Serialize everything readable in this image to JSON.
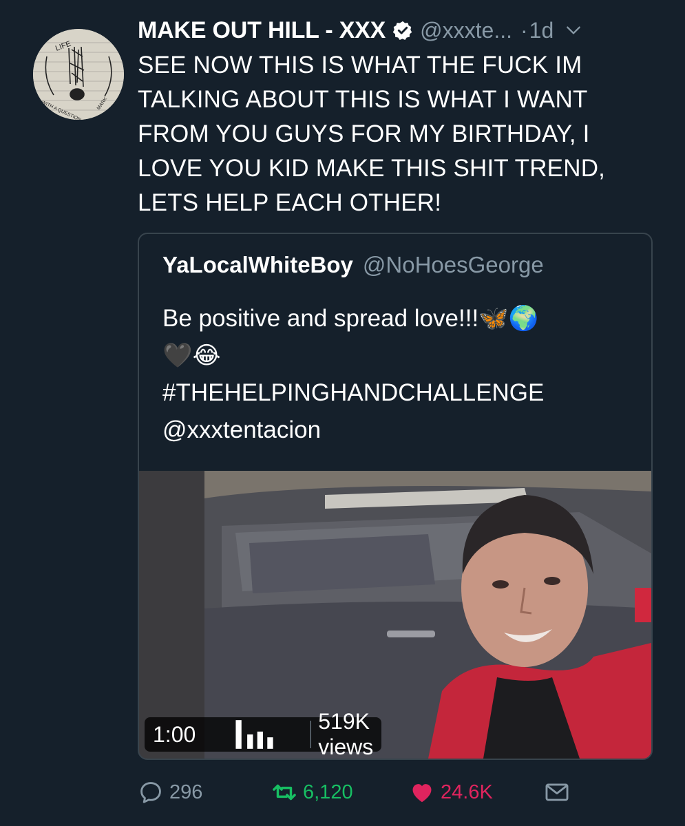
{
  "tweet": {
    "author_name": "MAKE OUT HILL - XXX",
    "handle": "@xxxte...",
    "separator": "·",
    "time": "1d",
    "text": "SEE NOW THIS IS WHAT THE FUCK IM TALKING ABOUT THIS IS WHAT I WANT FROM YOU GUYS FOR MY BIRTHDAY, I LOVE YOU KID MAKE THIS SHIT TREND, LETS HELP EACH OTHER!",
    "avatar_text": {
      "top": "LIFE",
      "bottom_left": "WITH A QUESTION",
      "bottom_right": "MARK"
    }
  },
  "quote": {
    "author_name": "YaLocalWhiteBoy",
    "handle": "@NoHoesGeorge",
    "line1": "Be positive and spread love!!!🦋🌍",
    "line2": "🖤😂",
    "hashtag": "#THEHELPINGHANDCHALLENGE",
    "mention": "@xxxtentacion",
    "video": {
      "duration": "1:00",
      "views": "519K views"
    }
  },
  "actions": {
    "replies": "296",
    "retweets": "6,120",
    "likes": "24.6K"
  },
  "colors": {
    "background": "#15202b",
    "secondary_text": "#8899a6",
    "border": "#38444d",
    "retweet": "#17bf63",
    "like": "#e0245e"
  },
  "icons": [
    "verified-badge-icon",
    "chevron-down-icon",
    "reply-icon",
    "retweet-icon",
    "heart-icon",
    "dm-envelope-icon",
    "signal-bars-icon"
  ]
}
